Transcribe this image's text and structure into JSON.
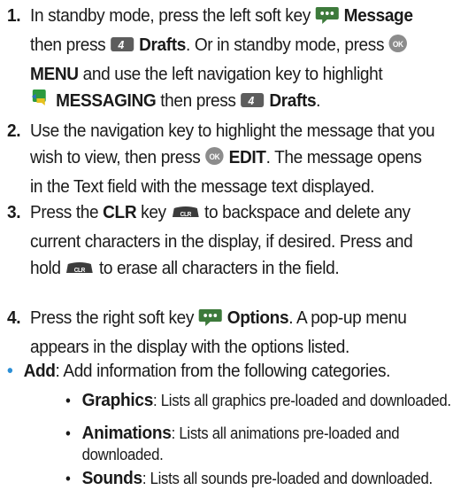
{
  "steps": [
    {
      "num": "1.",
      "a": "In standby mode, press the left soft key ",
      "b": "Message",
      "c": "then press ",
      "d": "Drafts",
      "e": ". Or in standby mode, press ",
      "f": "MENU",
      "g": " and use the left navigation key to highlight",
      "h": "MESSAGING",
      "i": " then press ",
      "j": "Drafts",
      "k": "."
    },
    {
      "num": "2.",
      "a": "Use the navigation key to highlight the message that you wish to view, then press ",
      "b": "EDIT",
      "c": ". The message opens in the Text field with the message text displayed."
    },
    {
      "num": "3.",
      "a": "Press the ",
      "b": "CLR",
      "c": " key ",
      "d": " to backspace and delete any current characters in the display, if desired. Press and hold ",
      "e": " to erase all characters in the field."
    },
    {
      "num": "4.",
      "a": "Press the right soft key ",
      "b": "Options",
      "c": ". A pop-up menu appears in the display with the options listed."
    }
  ],
  "add": {
    "label": "Add",
    "text": ": Add information from the following categories."
  },
  "subitems": [
    {
      "label": "Graphics",
      "text": ": Lists all graphics pre-loaded and downloaded."
    },
    {
      "label": "Animations",
      "text": ": Lists all animations pre-loaded and downloaded."
    },
    {
      "label": "Sounds",
      "text": ": Lists all sounds pre-loaded and downloaded."
    }
  ],
  "icons": {
    "ok_label": "OK",
    "clr_label": "CLR",
    "drafts_label": "4",
    "ok_color": "#8c8c8c",
    "softkey_color": "#3d7a3b",
    "bullet_color": "#2c8fd6"
  }
}
